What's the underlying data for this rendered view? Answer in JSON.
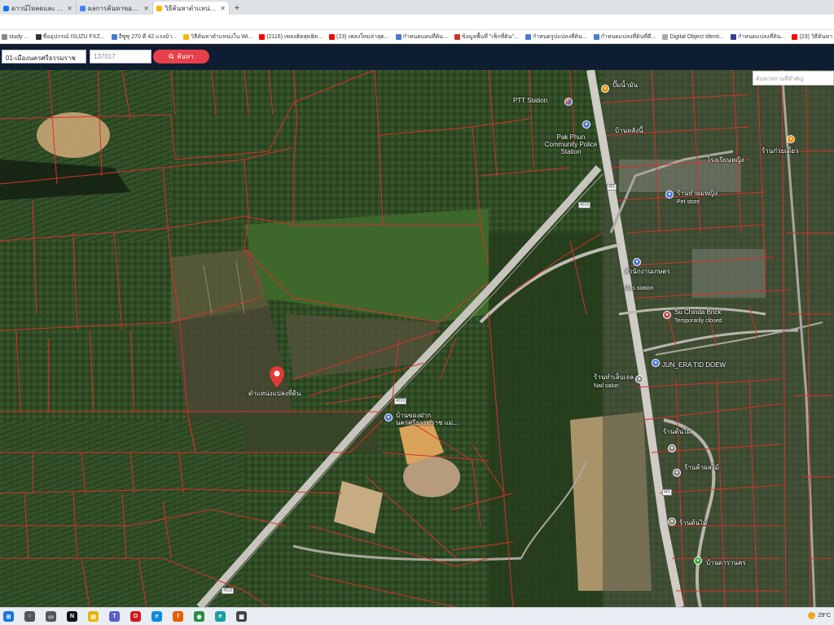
{
  "browser": {
    "tabs": [
      {
        "title": "ดาวน์โหลดและ Windows 10 -",
        "favicon_color": "#5b6ee1",
        "active": false
      },
      {
        "title": "ผลการค้นหาของ windows 10 - ค้นห",
        "favicon_color": "#4285f4",
        "active": false
      },
      {
        "title": "วิธีค้นหาตำแหน่งใน Windows 10",
        "favicon_color": "#f2b705",
        "active": true
      }
    ],
    "new_tab_label": "+",
    "bookmarks": [
      {
        "label": "study ...",
        "color": "#888888"
      },
      {
        "label": "ชื่ออุปกรณ์ ISUZU FXZ...",
        "color": "#333333"
      },
      {
        "label": "อีซูซุ 270 ดี 42 แรงม้า...",
        "color": "#4a7bd0"
      },
      {
        "label": "วิธีค้นหาตำแหน่งใน Wi...",
        "color": "#f2b705"
      },
      {
        "label": "(2116) เพลงฮิตสุดฮิต...",
        "color": "#ff0000"
      },
      {
        "label": "(23) เพลงใหม่ล่าสุด...",
        "color": "#ff0000"
      },
      {
        "label": "กำหนดแผนที่ดิน...",
        "color": "#4a7bd0"
      },
      {
        "label": "ข้อมูลพื้นที่ \"เช็กที่ดิน\"...",
        "color": "#c0392b"
      },
      {
        "label": "กำหนดรูปแปลงที่ดิน...",
        "color": "#4a7bd0"
      },
      {
        "label": "กำหนดแปลงที่ดินที่ดี...",
        "color": "#4a7bd0"
      },
      {
        "label": "Digital Object Identi...",
        "color": "#aaaaaa"
      },
      {
        "label": "กำหนดแปลงที่ดิน...",
        "color": "#3b3b8f"
      },
      {
        "label": "(23) วิธีค้นหา ๆ ที่ดิน...",
        "color": "#ff0000"
      }
    ]
  },
  "search": {
    "province_value": "01-เมืองนครศรีธรรมราช",
    "parcel_value": "137017",
    "button_label": "ค้นหา",
    "button_color": "#e8404a",
    "place_search_placeholder": "ค้นหาสถานที่สำคัญ"
  },
  "map": {
    "selected_parcel_label": "ตำแหน่งแปลงที่ดิน",
    "pin_color": "#e53935",
    "parcel_line_color": "#d9302a",
    "route_shields": [
      "4016",
      "4016",
      "4016",
      "401",
      "401"
    ],
    "places": [
      {
        "name": "PTT Station",
        "color": "#4a78d8"
      },
      {
        "name": "Pak Phun Community Police Station",
        "color": "#4a78d8"
      },
      {
        "name": "Su Chinda Brick",
        "sub": "Temporarily closed",
        "color": "#c05050"
      },
      {
        "name": "JUN_ERA TID DOEW",
        "color": "#4a78d8"
      },
      {
        "name": "บ้านของฝาก นครศรีธรรมราช แม่...",
        "color": "#4a78d8"
      },
      {
        "name": "ปั๊มน้ำมัน",
        "color": "#f08c00"
      },
      {
        "name": "บ้านหลังนี้",
        "color": "#ffffff"
      },
      {
        "name": "โรงเรียนหญิง",
        "color": "#ffffff"
      },
      {
        "name": "ร้านก๋วยเตี๋ยว",
        "color": "#f08c00"
      },
      {
        "name": "ร้านทำผมหญิง",
        "sub": "Pet store",
        "color": "#4a78d8"
      },
      {
        "name": "สำนักงานเกษตร",
        "sub": "Gas station",
        "color": "#4a78d8"
      },
      {
        "name": "ร้านทำเล็บเจล",
        "sub": "Nail salon",
        "color": "#888888"
      },
      {
        "name": "ร้านต้นไม้",
        "color": "#888888"
      },
      {
        "name": "ร้านต้นไม้",
        "color": "#888888"
      },
      {
        "name": "บ้านดารานคร",
        "color": "#3aaa35"
      },
      {
        "name": "ร้านค้าผลไม้",
        "color": "#888888"
      }
    ]
  },
  "taskbar": {
    "apps": [
      {
        "name": "start",
        "color": "#1a73e8",
        "glyph": "⊞"
      },
      {
        "name": "search",
        "color": "#555555",
        "glyph": "○"
      },
      {
        "name": "task-view",
        "color": "#555555",
        "glyph": "▭"
      },
      {
        "name": "netflix",
        "color": "#111111",
        "glyph": "N"
      },
      {
        "name": "explorer",
        "color": "#e8b400",
        "glyph": "▤"
      },
      {
        "name": "teams",
        "color": "#5b5fc7",
        "glyph": "T"
      },
      {
        "name": "opera",
        "color": "#d2191f",
        "glyph": "O"
      },
      {
        "name": "edge",
        "color": "#0c8bd9",
        "glyph": "e"
      },
      {
        "name": "firefox",
        "color": "#e66000",
        "glyph": "f"
      },
      {
        "name": "chrome",
        "color": "#2a8e40",
        "glyph": "◉"
      },
      {
        "name": "edge-dev",
        "color": "#1aa0a0",
        "glyph": "e"
      },
      {
        "name": "calculator",
        "color": "#444444",
        "glyph": "▦"
      }
    ],
    "weather": "29°C"
  }
}
